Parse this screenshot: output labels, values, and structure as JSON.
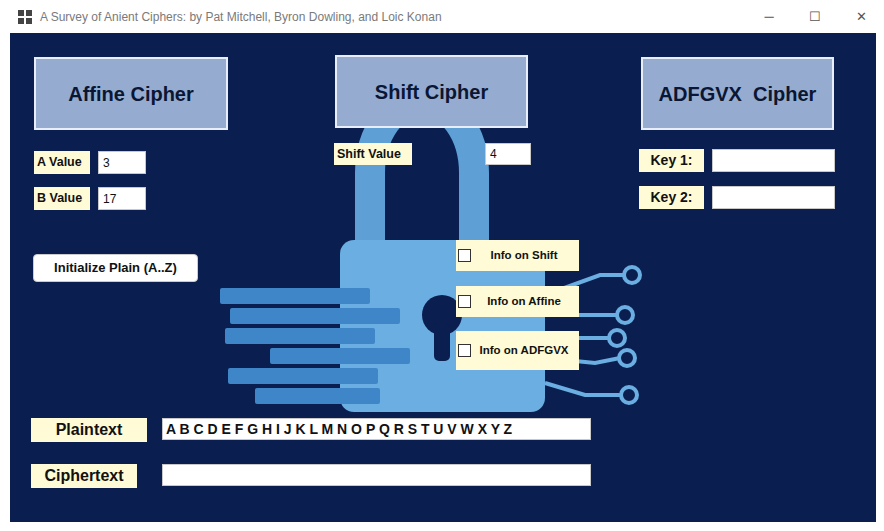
{
  "window": {
    "title": "A Survey of Anient Ciphers: by Pat Mitchell, Byron Dowling, and Loic Konan",
    "controls": [
      "─",
      "☐",
      "✕"
    ]
  },
  "ciphers": [
    {
      "title": "Affine Cipher",
      "fields": [
        {
          "label": "A Value",
          "value": "3"
        },
        {
          "label": "B Value",
          "value": "17"
        }
      ]
    },
    {
      "title": "Shift Cipher",
      "fields": [
        {
          "label": "Shift Value",
          "value": "4"
        }
      ]
    },
    {
      "title": "ADFGVX  Cipher",
      "fields": [
        {
          "label": "Key 1:",
          "value": ""
        },
        {
          "label": "Key 2:",
          "value": ""
        }
      ]
    }
  ],
  "init_button": "Initialize Plain (A..Z)",
  "info_checks": [
    {
      "label": "Info on Shift",
      "checked": false
    },
    {
      "label": "Info on Affine",
      "checked": false
    },
    {
      "label": "Info on ADFGVX",
      "checked": false
    }
  ],
  "plaintext": {
    "label": "Plaintext",
    "value": "A B C D E F G H I J K L M N O P Q R S T U V W X Y Z"
  },
  "ciphertext": {
    "label": "Ciphertext",
    "value": ""
  }
}
